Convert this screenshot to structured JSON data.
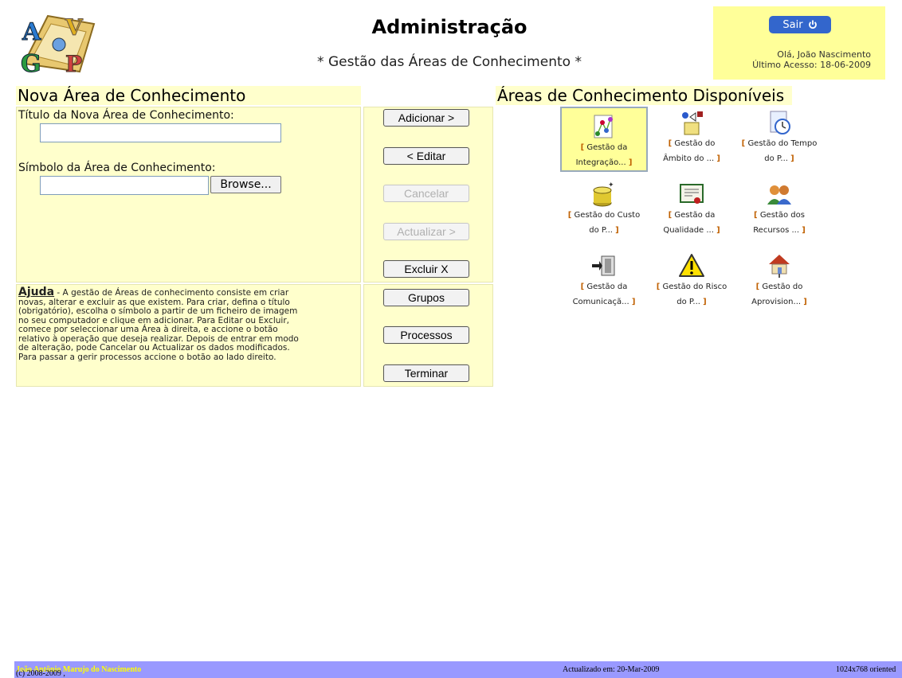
{
  "header": {
    "title": "Administração",
    "subtitle": "* Gestão das Áreas de Conhecimento *",
    "logout_label": "Sair",
    "greeting": "Olá, João Nascimento",
    "last_access": "Último Acesso: 18-06-2009"
  },
  "form": {
    "heading": "Nova Área de Conhecimento",
    "title_label": "Título da Nova Área de Conhecimento:",
    "title_value": "",
    "symbol_label": "Símbolo da Área de Conhecimento:",
    "symbol_value": "",
    "browse_label": "Browse..."
  },
  "actions": {
    "add": "Adicionar >",
    "edit": "< Editar",
    "cancel": "Cancelar",
    "update": "Actualizar >",
    "delete": "Excluir X",
    "groups": "Grupos",
    "processes": "Processos",
    "finish": "Terminar"
  },
  "help": {
    "title": "Ajuda",
    "lines": [
      " - A gestão de Áreas de conhecimento consiste em criar",
      "novas, alterar e excluir as que existem. Para criar, defina o título",
      "(obrigatório), escolha o símbolo a partir de um ficheiro de imagem",
      "no seu computador e clique em adicionar. Para Editar ou Excluir,",
      "comece por seleccionar uma Área à direita, e accione o botão",
      "relativo à operação que deseja realizar. Depois de entrar em modo",
      "de alteração, pode Cancelar ou Actualizar os dados modificados.",
      "Para passar a gerir processos accione o botão ao lado direito."
    ]
  },
  "areas": {
    "heading": "Áreas de Conhecimento Disponíveis",
    "items": [
      {
        "line1": "Gestão da",
        "line2": "Integração... ",
        "icon": "puzzle-network-icon",
        "selected": true
      },
      {
        "line1": "Gestão do",
        "line2": "Âmbito do ... ",
        "icon": "shapes-box-icon",
        "selected": false
      },
      {
        "line1": "Gestão do Tempo",
        "line2": "do P... ",
        "icon": "stopwatch-icon",
        "selected": false
      },
      {
        "line1": "Gestão do Custo",
        "line2": "do P... ",
        "icon": "coins-icon",
        "selected": false
      },
      {
        "line1": "Gestão da",
        "line2": "Qualidade ... ",
        "icon": "certificate-icon",
        "selected": false
      },
      {
        "line1": "Gestão dos",
        "line2": "Recursos ... ",
        "icon": "people-icon",
        "selected": false
      },
      {
        "line1": "Gestão da",
        "line2": "Comunicaçã... ",
        "icon": "network-transfer-icon",
        "selected": false
      },
      {
        "line1": "Gestão do Risco",
        "line2": "do P... ",
        "icon": "warning-icon",
        "selected": false
      },
      {
        "line1": "Gestão do",
        "line2": "Aprovision... ",
        "icon": "house-network-icon",
        "selected": false
      }
    ]
  },
  "footer": {
    "copyright": "(c) 2008-2009 , ",
    "author": "João Antônio Marujo do Nascimento",
    "updated": "Actualizado em: 20-Mar-2009",
    "resolution": "1024x768 oriented"
  },
  "colors": {
    "panel": "#ffffcc",
    "user_box": "#ffff99",
    "logout_button": "#3366cc",
    "footer": "#9999ff",
    "author_link": "#ffff00"
  }
}
